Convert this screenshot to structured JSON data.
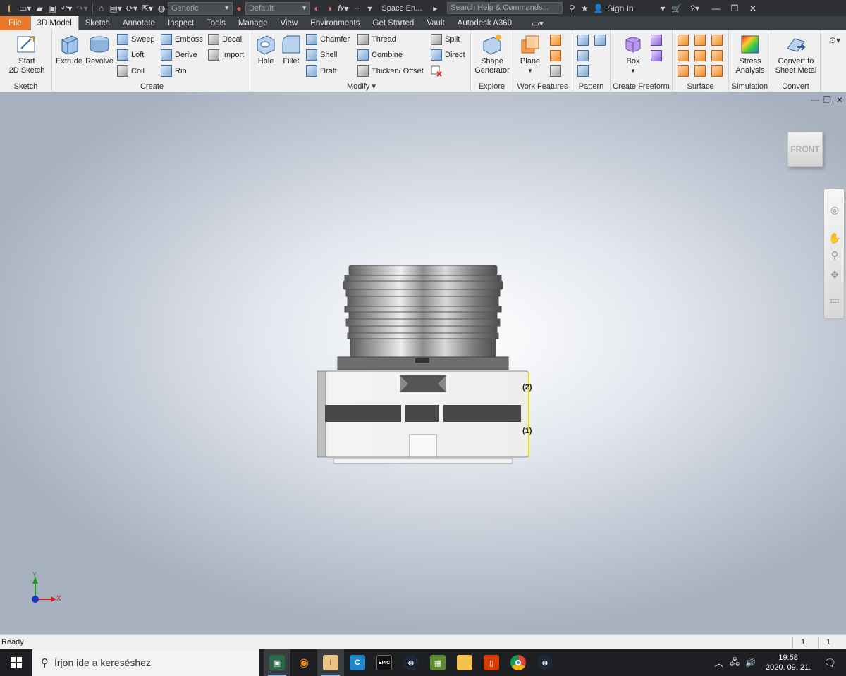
{
  "titlebar": {
    "appearance_dropdown": "Generic",
    "style_dropdown": "Default",
    "window_title": "Space En...",
    "search_placeholder": "Search Help & Commands...",
    "sign_in": "Sign In"
  },
  "tabs": [
    {
      "label": "File"
    },
    {
      "label": "3D Model"
    },
    {
      "label": "Sketch"
    },
    {
      "label": "Annotate"
    },
    {
      "label": "Inspect"
    },
    {
      "label": "Tools"
    },
    {
      "label": "Manage"
    },
    {
      "label": "View"
    },
    {
      "label": "Environments"
    },
    {
      "label": "Get Started"
    },
    {
      "label": "Vault"
    },
    {
      "label": "Autodesk A360"
    }
  ],
  "ribbon": {
    "sketch": {
      "label": "Sketch",
      "start_line1": "Start",
      "start_line2": "2D Sketch"
    },
    "create": {
      "label": "Create",
      "extrude": "Extrude",
      "revolve": "Revolve",
      "sweep": "Sweep",
      "loft": "Loft",
      "coil": "Coil",
      "emboss": "Emboss",
      "derive": "Derive",
      "rib": "Rib",
      "decal": "Decal",
      "import": "Import"
    },
    "modify": {
      "label": "Modify",
      "hole": "Hole",
      "fillet": "Fillet",
      "chamfer": "Chamfer",
      "shell": "Shell",
      "draft": "Draft",
      "thread": "Thread",
      "combine": "Combine",
      "thicken": "Thicken/ Offset",
      "split": "Split",
      "direct": "Direct"
    },
    "explore": {
      "label": "Explore",
      "shape_line1": "Shape",
      "shape_line2": "Generator"
    },
    "work_features": {
      "label": "Work Features",
      "plane": "Plane"
    },
    "pattern": {
      "label": "Pattern"
    },
    "freeform": {
      "label": "Create Freeform",
      "box": "Box"
    },
    "surface": {
      "label": "Surface"
    },
    "simulation": {
      "label": "Simulation",
      "stress_line1": "Stress",
      "stress_line2": "Analysis"
    },
    "convert": {
      "label": "Convert",
      "convert_line1": "Convert to",
      "convert_line2": "Sheet Metal"
    }
  },
  "viewport": {
    "viewcube_face": "FRONT",
    "annotation_2": "(2)",
    "annotation_1": "(1)",
    "axis_x": "X",
    "axis_y": "Y"
  },
  "status": {
    "text": "Ready",
    "count_a": "1",
    "count_b": "1"
  },
  "taskbar": {
    "search_placeholder": "Írjon ide a kereséshez",
    "time": "19:58",
    "date": "2020. 09. 21.",
    "epic_label": "EPIC"
  }
}
